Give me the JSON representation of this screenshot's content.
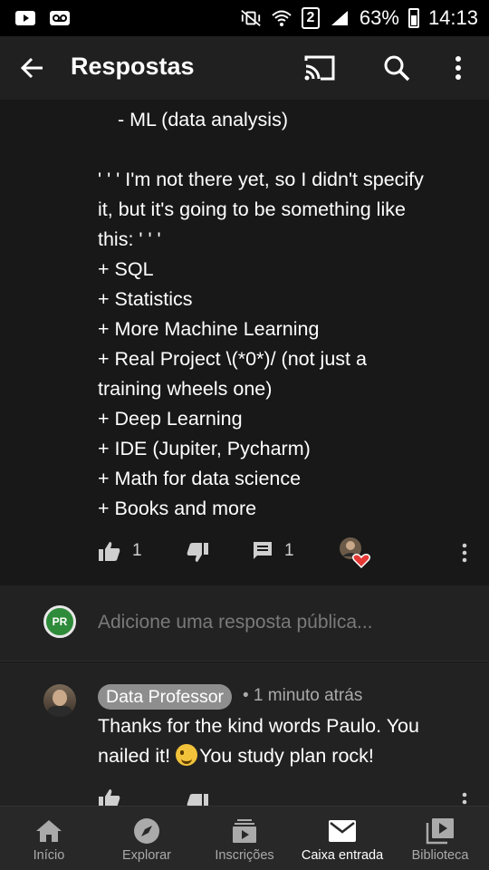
{
  "status_bar": {
    "left_icons": [
      "youtube-icon",
      "voicemail-icon"
    ],
    "sim": "2",
    "battery": "63%",
    "time": "14:13"
  },
  "app_bar": {
    "title": "Respostas"
  },
  "comment": {
    "lines": [
      "- ML (data analysis)",
      "",
      "' ' ' I'm not there yet, so I didn't specify",
      "it, but it's going to be something like",
      "this: ' ' '",
      "+ SQL",
      "+ Statistics",
      "+ More Machine Learning",
      "+ Real Project \\(*0*)/ (not just a",
      "training wheels one)",
      "+ Deep Learning",
      "+ IDE (Jupiter, Pycharm)",
      "+ Math for data science",
      "+ Books and more"
    ],
    "like_count": "1",
    "reply_count": "1"
  },
  "composer": {
    "avatar_initials": "PR",
    "placeholder": "Adicione uma resposta pública..."
  },
  "reply": {
    "author": "Data Professor",
    "meta": "• 1 minuto atrás",
    "text_before_emoji": "Thanks for the kind words Paulo. You nailed it! ",
    "text_after_emoji": "You study plan rock!"
  },
  "bottom_nav": {
    "items": [
      {
        "label": "Início",
        "icon": "home-icon"
      },
      {
        "label": "Explorar",
        "icon": "compass-icon"
      },
      {
        "label": "Inscrições",
        "icon": "subscriptions-icon"
      },
      {
        "label": "Caixa entrada",
        "icon": "inbox-icon"
      },
      {
        "label": "Biblioteca",
        "icon": "library-icon"
      }
    ],
    "active": "Caixa entrada"
  },
  "colors": {
    "background": "#181818",
    "app_bar": "#202020",
    "author_chip": "#8e8e8e",
    "heart": "#e53935",
    "composer_avatar": "#2e8b3a"
  }
}
